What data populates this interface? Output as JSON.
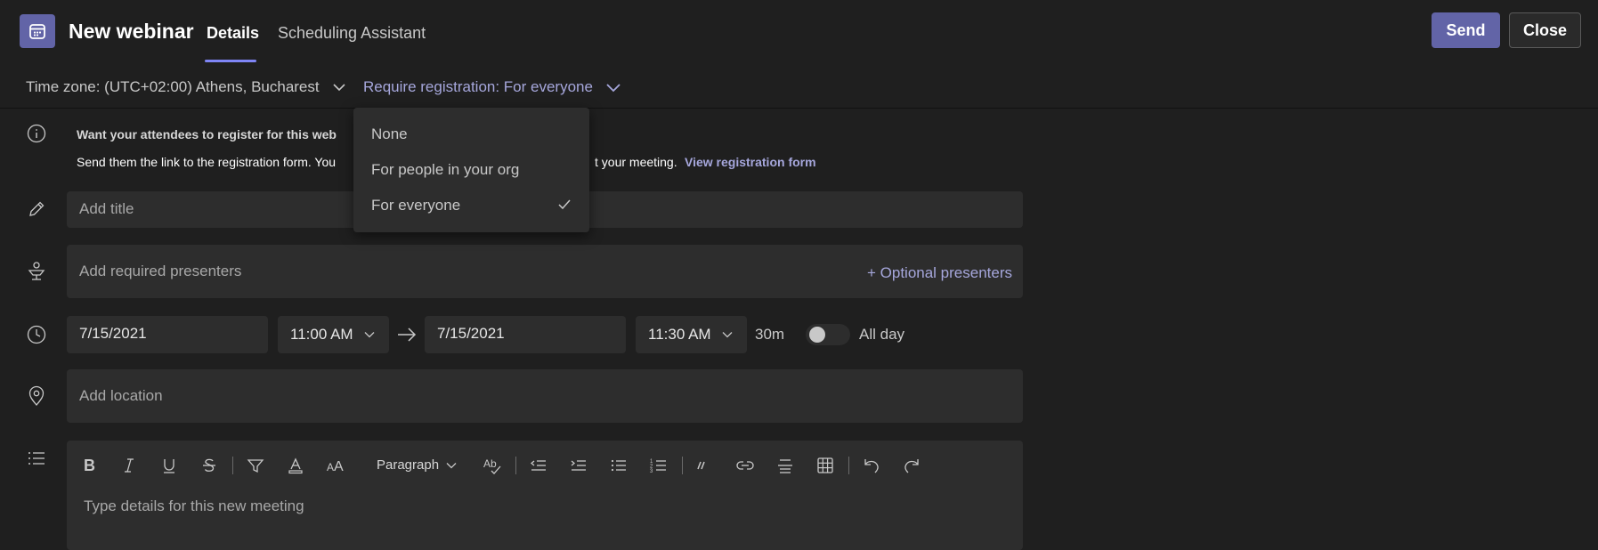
{
  "header": {
    "title": "New webinar",
    "tabs": [
      {
        "label": "Details",
        "active": true
      },
      {
        "label": "Scheduling Assistant",
        "active": false
      }
    ],
    "send_label": "Send",
    "close_label": "Close"
  },
  "subbar": {
    "timezone": "Time zone: (UTC+02:00) Athens, Bucharest",
    "registration": "Require registration: For everyone"
  },
  "info": {
    "title": "Want your attendees to register for this web",
    "body": "Send them the link to the registration form. You",
    "body_tail": "t your meeting.",
    "link": "View registration form"
  },
  "title_field": {
    "placeholder": "Add title"
  },
  "presenters": {
    "placeholder": "Add required presenters",
    "optional": "+ Optional presenters"
  },
  "schedule": {
    "start_date": "7/15/2021",
    "start_time": "11:00 AM",
    "end_date": "7/15/2021",
    "end_time": "11:30 AM",
    "duration": "30m",
    "all_day_label": "All day",
    "all_day_on": false
  },
  "location": {
    "placeholder": "Add location"
  },
  "editor": {
    "paragraph_label": "Paragraph",
    "placeholder": "Type details for this new meeting"
  },
  "dropdown": {
    "items": [
      {
        "label": "None",
        "selected": false
      },
      {
        "label": "For people in your org",
        "selected": false
      },
      {
        "label": "For everyone",
        "selected": true
      }
    ]
  },
  "colors": {
    "accent": "#6264a7",
    "link": "#a6a7dc",
    "background": "#1f1f1f",
    "field": "#2d2d2d"
  },
  "icons": {
    "app": "calendar-icon",
    "info": "info-icon",
    "title": "pencil-icon",
    "presenters": "presenter-icon",
    "time": "clock-icon",
    "location": "location-pin-icon",
    "details": "list-icon"
  }
}
